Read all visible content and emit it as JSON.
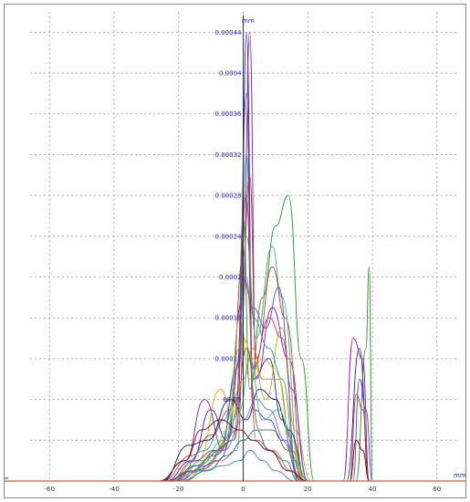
{
  "chart_data": {
    "type": "line",
    "title": "",
    "xlabel": "",
    "ylabel": "",
    "x_unit": "mm",
    "y_unit": "mm",
    "xlim": [
      -66,
      66
    ],
    "ylim": [
      0,
      0.00046
    ],
    "x_ticks": [
      -60,
      -40,
      -20,
      0,
      20,
      40,
      60
    ],
    "x_tick_labels": [
      "-60",
      "-40",
      "-20",
      "0",
      "20",
      "40",
      "60"
    ],
    "y_ticks": [
      4e-05,
      8e-05,
      0.00012,
      0.00016,
      0.0002,
      0.00024,
      0.00028,
      0.00032,
      0.00036,
      0.0004,
      0.00044
    ],
    "y_tick_labels": [
      "",
      "8E-05",
      "0.00012",
      "0.00016",
      "0.0002",
      "0.00024",
      "0.00028",
      "0.00032",
      "0.00036",
      "0.0004",
      "0.00044"
    ],
    "grid": true,
    "legend": "none",
    "series_colors": [
      "#1f1fbf",
      "#2e8b2e",
      "#8b1a8b",
      "#d4a017",
      "#1aa3a3",
      "#c0392b",
      "#6a3d9a",
      "#3cb371",
      "#e07b00",
      "#4b4bd8",
      "#0d0d6e",
      "#9acd32",
      "#b03060",
      "#20b2aa",
      "#556b2f",
      "#7b68ee",
      "#cd5c5c",
      "#008080",
      "#800000",
      "#4682b4"
    ],
    "series": [
      {
        "values": [
          [
            -24,
            0
          ],
          [
            -16,
            2e-05
          ],
          [
            -10,
            7e-05
          ],
          [
            -5,
            4e-05
          ],
          [
            -1,
            0.00012
          ],
          [
            1,
            0.00044
          ],
          [
            3,
            0.0001
          ],
          [
            8,
            0.00012
          ],
          [
            12,
            6e-05
          ],
          [
            18,
            0
          ],
          [
            32,
            0
          ],
          [
            36,
            0.00013
          ],
          [
            39,
            0
          ]
        ]
      },
      {
        "values": [
          [
            -22,
            0
          ],
          [
            -15,
            1.5e-05
          ],
          [
            -8,
            3e-05
          ],
          [
            -2,
            8e-05
          ],
          [
            0,
            0.00026
          ],
          [
            2,
            9e-05
          ],
          [
            6,
            0.00018
          ],
          [
            10,
            0.00025
          ],
          [
            14,
            0.00028
          ],
          [
            18,
            0.00012
          ],
          [
            22,
            0
          ],
          [
            35,
            0
          ],
          [
            38,
            0.00013
          ],
          [
            39,
            0.00021
          ],
          [
            40,
            0
          ]
        ]
      },
      {
        "values": [
          [
            -26,
            0
          ],
          [
            -18,
            2e-05
          ],
          [
            -12,
            8e-05
          ],
          [
            -6,
            3e-05
          ],
          [
            0,
            0.00018
          ],
          [
            2,
            0.00044
          ],
          [
            4,
            0.0001
          ],
          [
            9,
            0.00017
          ],
          [
            14,
            0.00012
          ],
          [
            20,
            0
          ],
          [
            31,
            0
          ],
          [
            34,
            0.00014
          ],
          [
            37,
            0.00012
          ],
          [
            39,
            0
          ]
        ]
      },
      {
        "values": [
          [
            -23,
            0
          ],
          [
            -14,
            2e-05
          ],
          [
            -7,
            9e-05
          ],
          [
            -3,
            6e-05
          ],
          [
            0,
            0.00014
          ],
          [
            3,
            0.00012
          ],
          [
            7,
            8e-05
          ],
          [
            12,
            0.00015
          ],
          [
            16,
            5e-05
          ],
          [
            21,
            0
          ]
        ]
      },
      {
        "values": [
          [
            -21,
            0
          ],
          [
            -12,
            3e-05
          ],
          [
            -6,
            6e-05
          ],
          [
            -1,
            0.00013
          ],
          [
            1,
            0.00032
          ],
          [
            3,
            0.00016
          ],
          [
            8,
            0.00013
          ],
          [
            12,
            0.0001
          ],
          [
            17,
            0
          ]
        ]
      },
      {
        "values": [
          [
            -25,
            0
          ],
          [
            -16,
            2.5e-05
          ],
          [
            -10,
            4.5e-05
          ],
          [
            -4,
            7e-05
          ],
          [
            0,
            0.00022
          ],
          [
            2,
            0.0003
          ],
          [
            4,
            0.00012
          ],
          [
            9,
            0.00021
          ],
          [
            13,
            0.00016
          ],
          [
            19,
            0
          ],
          [
            33,
            0
          ],
          [
            35,
            8.5e-05
          ],
          [
            37,
            7e-05
          ],
          [
            39,
            0
          ]
        ]
      },
      {
        "values": [
          [
            -24,
            0
          ],
          [
            -15,
            1e-05
          ],
          [
            -8,
            2e-05
          ],
          [
            -2,
            5e-05
          ],
          [
            1,
            0.00038
          ],
          [
            3,
            7e-05
          ],
          [
            8,
            6e-05
          ],
          [
            12,
            4e-05
          ],
          [
            18,
            0
          ]
        ]
      },
      {
        "values": [
          [
            -20,
            0
          ],
          [
            -13,
            2e-05
          ],
          [
            -6,
            4e-05
          ],
          [
            -1,
            9e-05
          ],
          [
            1,
            0.00024
          ],
          [
            4,
            0.00014
          ],
          [
            9,
            0.00023
          ],
          [
            12,
            0.00018
          ],
          [
            18,
            0
          ]
        ]
      },
      {
        "values": [
          [
            -19,
            0
          ],
          [
            -11,
            1.5e-05
          ],
          [
            -5,
            4e-05
          ],
          [
            0,
            0.0001
          ],
          [
            3,
            0.00013
          ],
          [
            6,
            0.0001
          ],
          [
            11,
            0.0001
          ],
          [
            15,
            3e-05
          ],
          [
            19,
            0
          ]
        ]
      },
      {
        "values": [
          [
            -22,
            0
          ],
          [
            -14,
            1.5e-05
          ],
          [
            -7,
            3e-05
          ],
          [
            -2,
            0.00011
          ],
          [
            0,
            0.0002
          ],
          [
            3,
            0.00017
          ],
          [
            7,
            0.00015
          ],
          [
            11,
            0.00019
          ],
          [
            15,
            9e-05
          ],
          [
            20,
            0
          ],
          [
            34,
            0
          ],
          [
            36,
            0.0001
          ],
          [
            38,
            7e-05
          ],
          [
            40,
            0
          ]
        ]
      },
      {
        "values": [
          [
            -25,
            0
          ],
          [
            -17,
            3.5e-05
          ],
          [
            -11,
            4e-05
          ],
          [
            -4,
            8e-05
          ],
          [
            1,
            6e-05
          ],
          [
            5,
            9e-05
          ],
          [
            10,
            8e-05
          ],
          [
            14,
            5e-05
          ],
          [
            20,
            0
          ]
        ]
      },
      {
        "values": [
          [
            -18,
            0
          ],
          [
            -10,
            2e-05
          ],
          [
            -5,
            5e-05
          ],
          [
            -1,
            0.00016
          ],
          [
            2,
            0.0001
          ],
          [
            6,
            0.00012
          ],
          [
            10,
            0.00011
          ],
          [
            15,
            4e-05
          ],
          [
            19,
            0
          ]
        ]
      },
      {
        "values": [
          [
            -23,
            0
          ],
          [
            -15,
            2e-05
          ],
          [
            -9,
            3e-05
          ],
          [
            -3,
            4e-05
          ],
          [
            1,
            0.00028
          ],
          [
            3,
            0.00011
          ],
          [
            8,
            0.00016
          ],
          [
            12,
            0.00014
          ],
          [
            17,
            0
          ]
        ]
      },
      {
        "values": [
          [
            -21,
            0
          ],
          [
            -12,
            1.2e-05
          ],
          [
            -6,
            3.5e-05
          ],
          [
            -1,
            7e-05
          ],
          [
            2,
            0.00012
          ],
          [
            6,
            6e-05
          ],
          [
            11,
            7e-05
          ],
          [
            16,
            2e-05
          ],
          [
            20,
            0
          ]
        ]
      },
      {
        "values": [
          [
            -24,
            0
          ],
          [
            -16,
            1e-05
          ],
          [
            -9,
            2.5e-05
          ],
          [
            -3,
            4e-05
          ],
          [
            1,
            0.00013
          ],
          [
            5,
            5e-05
          ],
          [
            9,
            5e-05
          ],
          [
            14,
            3e-05
          ],
          [
            19,
            0
          ]
        ]
      },
      {
        "values": [
          [
            -20,
            0
          ],
          [
            -12,
            1.5e-05
          ],
          [
            -6,
            3e-05
          ],
          [
            0,
            6e-05
          ],
          [
            4,
            8e-05
          ],
          [
            8,
            7e-05
          ],
          [
            13,
            4e-05
          ],
          [
            18,
            0
          ]
        ]
      },
      {
        "values": [
          [
            -22,
            0
          ],
          [
            -14,
            1e-05
          ],
          [
            -7,
            2e-05
          ],
          [
            -2,
            3e-05
          ],
          [
            1,
            0.0002
          ],
          [
            4,
            4e-05
          ],
          [
            9,
            3e-05
          ],
          [
            15,
            1e-05
          ],
          [
            19,
            0
          ]
        ]
      },
      {
        "values": [
          [
            -19,
            0
          ],
          [
            -11,
            1e-05
          ],
          [
            -5,
            2.5e-05
          ],
          [
            0,
            4e-05
          ],
          [
            4,
            5e-05
          ],
          [
            8,
            3e-05
          ],
          [
            13,
            2e-05
          ],
          [
            17,
            0
          ]
        ]
      },
      {
        "values": [
          [
            -26,
            0
          ],
          [
            -18,
            2e-05
          ],
          [
            -13,
            5e-05
          ],
          [
            -7,
            6e-05
          ],
          [
            -1,
            5e-05
          ],
          [
            3,
            4e-05
          ],
          [
            8,
            3e-05
          ],
          [
            14,
            1e-05
          ],
          [
            20,
            0
          ],
          [
            33,
            0
          ],
          [
            35,
            4e-05
          ],
          [
            37,
            3e-05
          ],
          [
            39,
            0
          ]
        ]
      },
      {
        "values": [
          [
            -21,
            0
          ],
          [
            -13,
            1e-05
          ],
          [
            -6,
            1.5e-05
          ],
          [
            -1,
            2e-05
          ],
          [
            2,
            3e-05
          ],
          [
            6,
            2e-05
          ],
          [
            10,
            1e-05
          ],
          [
            16,
            0
          ]
        ]
      }
    ]
  }
}
